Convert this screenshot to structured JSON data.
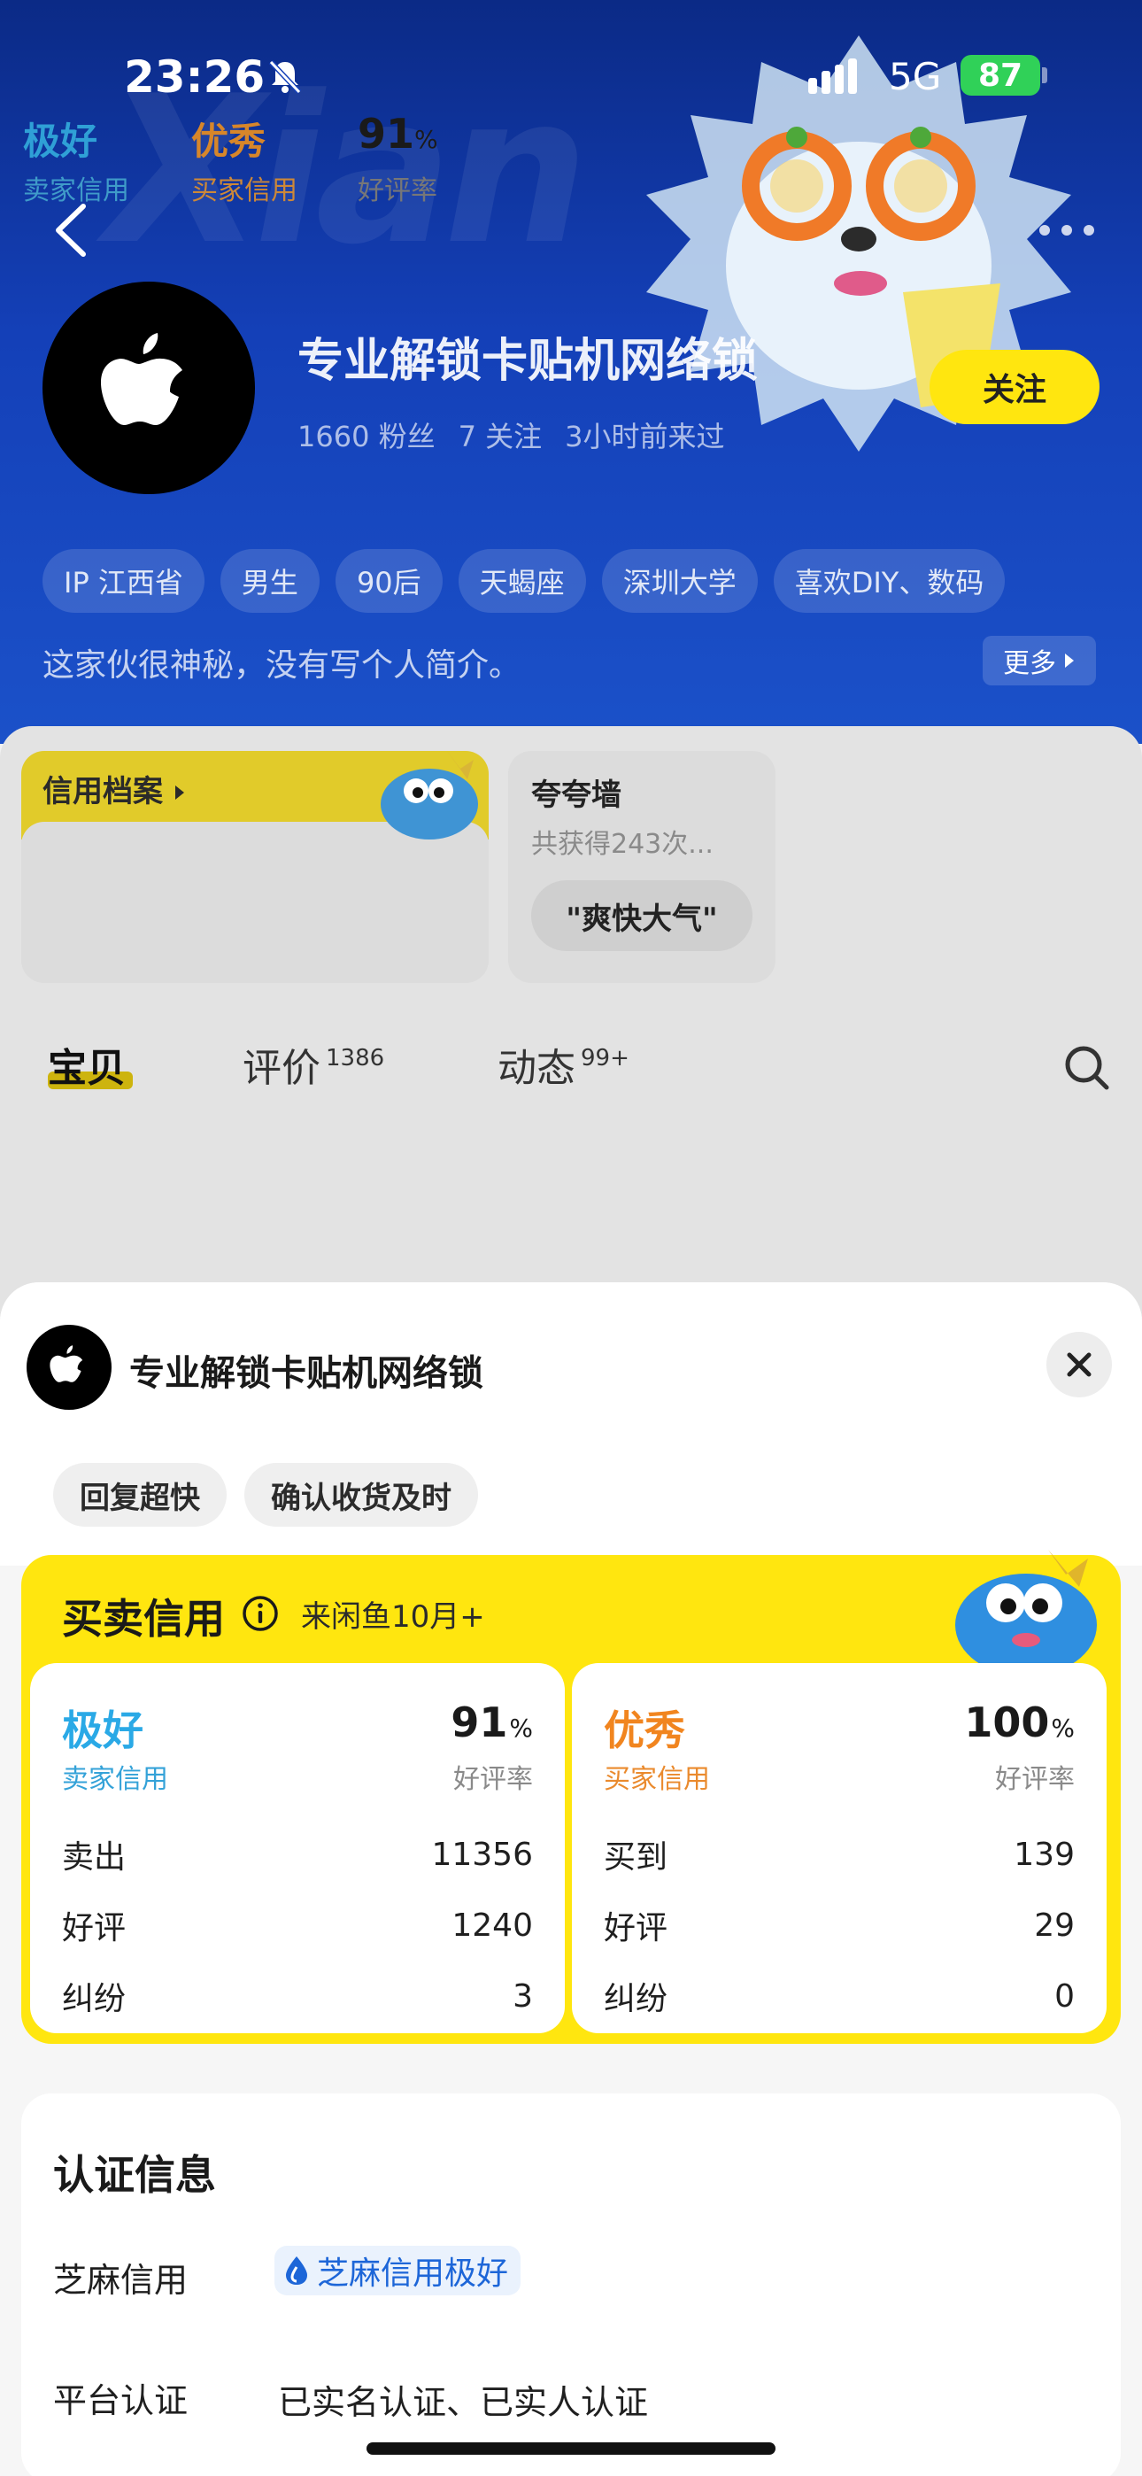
{
  "status_bar": {
    "time": "23:26",
    "network": "5G",
    "battery": "87"
  },
  "profile": {
    "name": "专业解锁卡贴机网络锁",
    "fans": "1660 粉丝",
    "following": "7 关注",
    "last_seen": "3小时前来过",
    "follow_label": "关注",
    "tags": [
      "IP 江西省",
      "男生",
      "90后",
      "天蝎座",
      "深圳大学",
      "喜欢DIY、数码"
    ],
    "bio": "这家伙很神秘，没有写个人简介。",
    "more_label": "更多"
  },
  "credit_summary": {
    "title": "信用档案",
    "seller_rating": "极好",
    "seller_label": "卖家信用",
    "buyer_rating": "优秀",
    "buyer_label": "买家信用",
    "good_rate": "91",
    "good_rate_unit": "%",
    "good_rate_label": "好评率"
  },
  "praise_wall": {
    "title": "夸夸墙",
    "subtitle": "共获得243次...",
    "chip": "\"爽快大气\""
  },
  "tabs": [
    {
      "label": "宝贝",
      "count": ""
    },
    {
      "label": "评价",
      "count": "1386"
    },
    {
      "label": "动态",
      "count": "99+"
    }
  ],
  "sheet": {
    "name": "专业解锁卡贴机网络锁",
    "chips": [
      "回复超快",
      "确认收货及时"
    ],
    "credit": {
      "title": "买卖信用",
      "since": "来闲鱼10月+",
      "seller": {
        "rating": "极好",
        "label": "卖家信用",
        "rate": "91",
        "rate_unit": "%",
        "rate_label": "好评率",
        "rows": [
          {
            "label": "卖出",
            "value": "11356"
          },
          {
            "label": "好评",
            "value": "1240"
          },
          {
            "label": "纠纷",
            "value": "3"
          }
        ]
      },
      "buyer": {
        "rating": "优秀",
        "label": "买家信用",
        "rate": "100",
        "rate_unit": "%",
        "rate_label": "好评率",
        "rows": [
          {
            "label": "买到",
            "value": "139"
          },
          {
            "label": "好评",
            "value": "29"
          },
          {
            "label": "纠纷",
            "value": "0"
          }
        ]
      }
    },
    "auth": {
      "title": "认证信息",
      "zhima_label": "芝麻信用",
      "zhima_value": "芝麻信用极好",
      "platform_label": "平台认证",
      "platform_value": "已实名认证、已实人认证"
    }
  },
  "colors": {
    "hero_blue": "#1440b8",
    "brand_yellow": "#ffe60f",
    "seller_blue": "#2aa9e6",
    "buyer_orange": "#f1851f"
  },
  "icons": [
    "bell-slash-icon",
    "signal-icon",
    "back-arrow-icon",
    "more-dots-icon",
    "apple-logo-icon",
    "chevron-right-icon",
    "search-icon",
    "close-icon",
    "info-icon",
    "zhima-drop-icon"
  ]
}
